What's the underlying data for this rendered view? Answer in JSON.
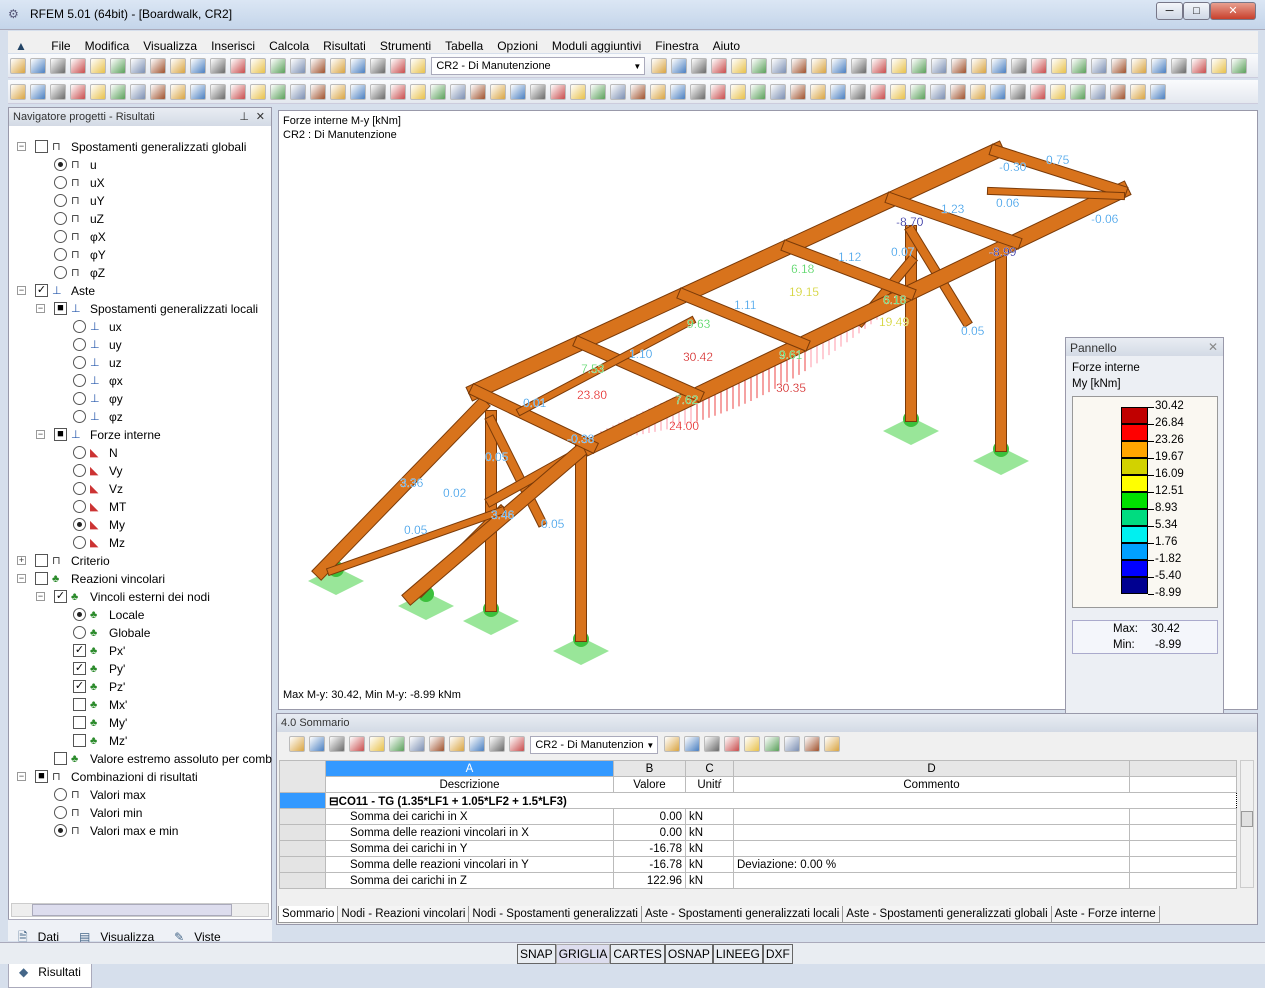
{
  "window": {
    "title": "RFEM 5.01 (64bit) - [Boardwalk, CR2]",
    "minimize": "─",
    "maximize": "□",
    "close": "✕"
  },
  "menu": [
    "File",
    "Modifica",
    "Visualizza",
    "Inserisci",
    "Calcola",
    "Risultati",
    "Strumenti",
    "Tabella",
    "Opzioni",
    "Moduli aggiuntivi",
    "Finestra",
    "Aiuto"
  ],
  "toolbar": {
    "load_case": "CR2 - Di Manutenzione"
  },
  "navigator": {
    "title": "Navigatore progetti - Risultati",
    "items": [
      {
        "level": 0,
        "exp": "-",
        "ctl": "cb",
        "state": "",
        "icon": "beam",
        "label": "Spostamenti generalizzati globali"
      },
      {
        "level": 1,
        "ctl": "rb",
        "state": "on",
        "icon": "beam",
        "label": "u"
      },
      {
        "level": 1,
        "ctl": "rb",
        "state": "",
        "icon": "beam",
        "label": "uX"
      },
      {
        "level": 1,
        "ctl": "rb",
        "state": "",
        "icon": "beam",
        "label": "uY"
      },
      {
        "level": 1,
        "ctl": "rb",
        "state": "",
        "icon": "beam",
        "label": "uZ"
      },
      {
        "level": 1,
        "ctl": "rb",
        "state": "",
        "icon": "beam",
        "label": "φX"
      },
      {
        "level": 1,
        "ctl": "rb",
        "state": "",
        "icon": "beam",
        "label": "φY"
      },
      {
        "level": 1,
        "ctl": "rb",
        "state": "",
        "icon": "beam",
        "label": "φZ"
      },
      {
        "level": 0,
        "exp": "-",
        "ctl": "cb",
        "state": "✓",
        "icon": "member",
        "label": "Aste"
      },
      {
        "level": 1,
        "exp": "-",
        "ctl": "cb",
        "state": "■",
        "icon": "member",
        "label": "Spostamenti generalizzati locali"
      },
      {
        "level": 2,
        "ctl": "rb",
        "state": "",
        "icon": "member",
        "label": "ux"
      },
      {
        "level": 2,
        "ctl": "rb",
        "state": "",
        "icon": "member",
        "label": "uy"
      },
      {
        "level": 2,
        "ctl": "rb",
        "state": "",
        "icon": "member",
        "label": "uz"
      },
      {
        "level": 2,
        "ctl": "rb",
        "state": "",
        "icon": "member",
        "label": "φx"
      },
      {
        "level": 2,
        "ctl": "rb",
        "state": "",
        "icon": "member",
        "label": "φy"
      },
      {
        "level": 2,
        "ctl": "rb",
        "state": "",
        "icon": "member",
        "label": "φz"
      },
      {
        "level": 1,
        "exp": "-",
        "ctl": "cb",
        "state": "■",
        "icon": "member",
        "label": "Forze interne"
      },
      {
        "level": 2,
        "ctl": "rb",
        "state": "",
        "icon": "force",
        "label": "N"
      },
      {
        "level": 2,
        "ctl": "rb",
        "state": "",
        "icon": "force",
        "label": "Vy"
      },
      {
        "level": 2,
        "ctl": "rb",
        "state": "",
        "icon": "force",
        "label": "Vz"
      },
      {
        "level": 2,
        "ctl": "rb",
        "state": "",
        "icon": "force",
        "label": "MT"
      },
      {
        "level": 2,
        "ctl": "rb",
        "state": "on",
        "icon": "force",
        "label": "My"
      },
      {
        "level": 2,
        "ctl": "rb",
        "state": "",
        "icon": "force",
        "label": "Mz"
      },
      {
        "level": 0,
        "exp": "+",
        "ctl": "cb",
        "state": "",
        "icon": "beam",
        "label": "Criterio"
      },
      {
        "level": 0,
        "exp": "-",
        "ctl": "cb",
        "state": "",
        "icon": "support",
        "label": "Reazioni vincolari"
      },
      {
        "level": 1,
        "exp": "-",
        "ctl": "cb",
        "state": "✓",
        "icon": "support",
        "label": "Vincoli esterni dei nodi"
      },
      {
        "level": 2,
        "ctl": "rb",
        "state": "on",
        "icon": "support",
        "label": "Locale"
      },
      {
        "level": 2,
        "ctl": "rb",
        "state": "",
        "icon": "support",
        "label": "Globale"
      },
      {
        "level": 2,
        "ctl": "cb",
        "state": "✓",
        "icon": "support",
        "label": "Px'"
      },
      {
        "level": 2,
        "ctl": "cb",
        "state": "✓",
        "icon": "support",
        "label": "Py'"
      },
      {
        "level": 2,
        "ctl": "cb",
        "state": "✓",
        "icon": "support",
        "label": "Pz'"
      },
      {
        "level": 2,
        "ctl": "cb",
        "state": "",
        "icon": "support",
        "label": "Mx'"
      },
      {
        "level": 2,
        "ctl": "cb",
        "state": "",
        "icon": "support",
        "label": "My'"
      },
      {
        "level": 2,
        "ctl": "cb",
        "state": "",
        "icon": "support",
        "label": "Mz'"
      },
      {
        "level": 1,
        "ctl": "cb",
        "state": "",
        "icon": "support",
        "label": "Valore estremo assoluto per comb"
      },
      {
        "level": 0,
        "exp": "-",
        "ctl": "cb",
        "state": "■",
        "icon": "beam",
        "label": "Combinazioni di risultati"
      },
      {
        "level": 1,
        "ctl": "rb",
        "state": "",
        "icon": "beam",
        "label": "Valori max"
      },
      {
        "level": 1,
        "ctl": "rb",
        "state": "",
        "icon": "beam",
        "label": "Valori min"
      },
      {
        "level": 1,
        "ctl": "rb",
        "state": "on",
        "icon": "beam",
        "label": "Valori max e min"
      }
    ],
    "tabs": [
      "Dati",
      "Visualizza",
      "Viste",
      "Risultati"
    ]
  },
  "viewport": {
    "line1": "Forze interne M-y [kNm]",
    "line2": "CR2 : Di Manutenzione",
    "footer": "Max M-y: 30.42, Min M-y: -8.99 kNm",
    "labels": [
      {
        "text": "-0.30",
        "color": "#1e8fe6"
      },
      {
        "text": "0.75",
        "color": "#1e8fe6"
      },
      {
        "text": "1.23",
        "color": "#1e8fe6"
      },
      {
        "text": "0.06",
        "color": "#1e8fe6"
      },
      {
        "text": "-0.06",
        "color": "#1e8fe6"
      },
      {
        "text": "-8.70",
        "color": "#00008b"
      },
      {
        "text": "-8.99",
        "color": "#00008b"
      },
      {
        "text": "0.07",
        "color": "#1e8fe6"
      },
      {
        "text": "1.12",
        "color": "#1e8fe6"
      },
      {
        "text": "6.18",
        "color": "#2ecc40"
      },
      {
        "text": "19.15",
        "color": "#c8c800"
      },
      {
        "text": "6.18",
        "color": "#2ecc40"
      },
      {
        "text": "19.49",
        "color": "#c8c800"
      },
      {
        "text": "0.05",
        "color": "#1e8fe6"
      },
      {
        "text": "1.11",
        "color": "#1e8fe6"
      },
      {
        "text": "9.63",
        "color": "#2ecc40"
      },
      {
        "text": "30.42",
        "color": "#cc0000"
      },
      {
        "text": "9.61",
        "color": "#2ecc40"
      },
      {
        "text": "1.10",
        "color": "#1e8fe6"
      },
      {
        "text": "7.53",
        "color": "#2ecc40"
      },
      {
        "text": "30.35",
        "color": "#cc0000"
      },
      {
        "text": "23.80",
        "color": "#e00000"
      },
      {
        "text": "7.62",
        "color": "#2ecc40"
      },
      {
        "text": "24.00",
        "color": "#e00000"
      },
      {
        "text": "0.01",
        "color": "#1e8fe6"
      },
      {
        "text": "-0.38",
        "color": "#1e8fe6"
      },
      {
        "text": "0.05",
        "color": "#1e8fe6"
      },
      {
        "text": "3.36",
        "color": "#1e8fe6"
      },
      {
        "text": "0.02",
        "color": "#1e8fe6"
      },
      {
        "text": "3.46",
        "color": "#1e8fe6"
      },
      {
        "text": "0.05",
        "color": "#1e8fe6"
      },
      {
        "text": "0.05",
        "color": "#1e8fe6"
      }
    ]
  },
  "panel": {
    "title": "Pannello",
    "subtitle": "Forze interne",
    "unit": "My [kNm]",
    "legend_values": [
      "30.42",
      "26.84",
      "23.26",
      "19.67",
      "16.09",
      "12.51",
      "8.93",
      "5.34",
      "1.76",
      "-1.82",
      "-5.40",
      "-8.99"
    ],
    "legend_colors": [
      "#c00000",
      "#ff0000",
      "#ffa500",
      "#d2d200",
      "#ffff00",
      "#00e000",
      "#00dc80",
      "#00f0f0",
      "#00a0ff",
      "#0000ff",
      "#000090"
    ],
    "max_label": "Max:",
    "max": "30.42",
    "min_label": "Min:",
    "min": "-8.99"
  },
  "summary": {
    "title": "4.0 Sommario",
    "load_case": "CR2 - Di Manutenzion",
    "col_letters": [
      "A",
      "B",
      "C",
      "D"
    ],
    "col_names": [
      "Descrizione",
      "Valore",
      "Unitŕ",
      "Commento"
    ],
    "group": "CO11 - TG  (1.35*LF1 + 1.05*LF2 + 1.5*LF3)",
    "rows": [
      {
        "desc": "Somma dei carichi in X",
        "value": "0.00",
        "unit": "kN",
        "comment": ""
      },
      {
        "desc": "Somma delle reazioni vincolari in X",
        "value": "0.00",
        "unit": "kN",
        "comment": ""
      },
      {
        "desc": "Somma dei carichi in Y",
        "value": "-16.78",
        "unit": "kN",
        "comment": ""
      },
      {
        "desc": "Somma delle reazioni vincolari in Y",
        "value": "-16.78",
        "unit": "kN",
        "comment": "Deviazione:  0.00 %"
      },
      {
        "desc": "Somma dei carichi in Z",
        "value": "122.96",
        "unit": "kN",
        "comment": ""
      }
    ],
    "tabs": [
      "Sommario",
      "Nodi - Reazioni vincolari",
      "Nodi - Spostamenti generalizzati",
      "Aste - Spostamenti generalizzati locali",
      "Aste - Spostamenti generalizzati globali",
      "Aste - Forze interne"
    ]
  },
  "status": [
    "SNAP",
    "GRIGLIA",
    "CARTES",
    "OSNAP",
    "LINEEG",
    "DXF"
  ]
}
